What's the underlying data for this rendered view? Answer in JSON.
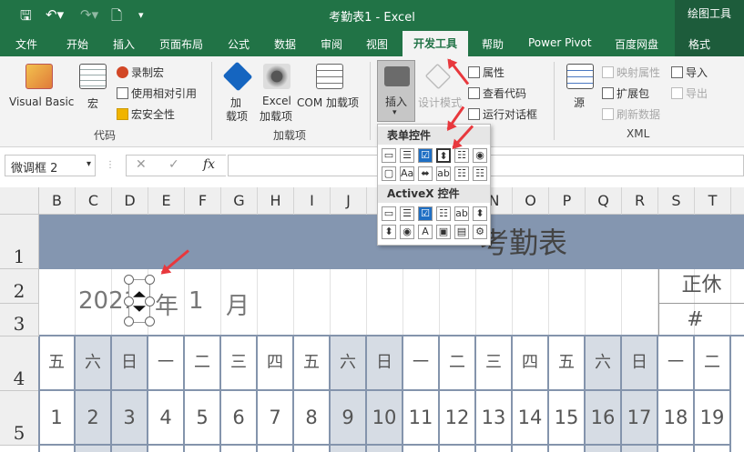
{
  "window": {
    "title": "考勤表1  -  Excel",
    "context_title": "绘图工具"
  },
  "tabs": [
    "文件",
    "开始",
    "插入",
    "页面布局",
    "公式",
    "数据",
    "审阅",
    "视图",
    "开发工具",
    "帮助",
    "Power Pivot",
    "百度网盘",
    "格式"
  ],
  "ribbon": {
    "code_group": {
      "visual_basic": "Visual Basic",
      "macros": "宏",
      "record_macro": "录制宏",
      "use_relative_refs": "使用相对引用",
      "macro_security": "宏安全性",
      "label": "代码"
    },
    "addins_group": {
      "addins_1": "加",
      "addins_2": "载项",
      "excel_addins_1": "Excel",
      "excel_addins_2": "加载项",
      "com_addins": "COM 加载项",
      "label": "加载项"
    },
    "controls_group": {
      "insert": "插入",
      "design_mode": "设计模式",
      "properties": "属性",
      "view_code": "查看代码",
      "run_dialog": "运行对话框"
    },
    "xml_group": {
      "source": "源",
      "map_properties": "映射属性",
      "expansion_packs": "扩展包",
      "refresh_data": "刷新数据",
      "import": "导入",
      "export": "导出",
      "label": "XML"
    }
  },
  "insert_menu": {
    "form_controls": "表单控件",
    "activex_controls": "ActiveX 控件"
  },
  "formula_bar": {
    "name_box": "微调框 2",
    "fx": "fx",
    "cancel": "✕",
    "enter": "✓"
  },
  "columns": [
    "B",
    "C",
    "D",
    "E",
    "F",
    "G",
    "H",
    "I",
    "J",
    "K",
    "L",
    "M",
    "N",
    "O",
    "P",
    "Q",
    "R",
    "S",
    "T"
  ],
  "rows": [
    "1",
    "2",
    "3",
    "4",
    "5"
  ],
  "sheet": {
    "title": "考勤表",
    "year": "2021",
    "year_suffix": "年",
    "month": "1",
    "month_suffix": "月",
    "rest_label": "正休",
    "rest_hash": "#",
    "weekdays": [
      "五",
      "六",
      "日",
      "一",
      "二",
      "三",
      "四",
      "五",
      "六",
      "日",
      "一",
      "二",
      "三",
      "四",
      "五",
      "六",
      "日",
      "一",
      "二"
    ],
    "days": [
      "1",
      "2",
      "3",
      "4",
      "5",
      "6",
      "7",
      "8",
      "9",
      "10",
      "11",
      "12",
      "13",
      "14",
      "15",
      "16",
      "17",
      "18",
      "19"
    ],
    "weekend_indices": [
      1,
      2,
      8,
      9,
      15,
      16
    ]
  },
  "colors": {
    "excel_green": "#217346",
    "title_band": "#8496b0",
    "weekend_fill": "#d6dce4",
    "grid_line": "#8494ac",
    "arrow": "#e8383d"
  }
}
